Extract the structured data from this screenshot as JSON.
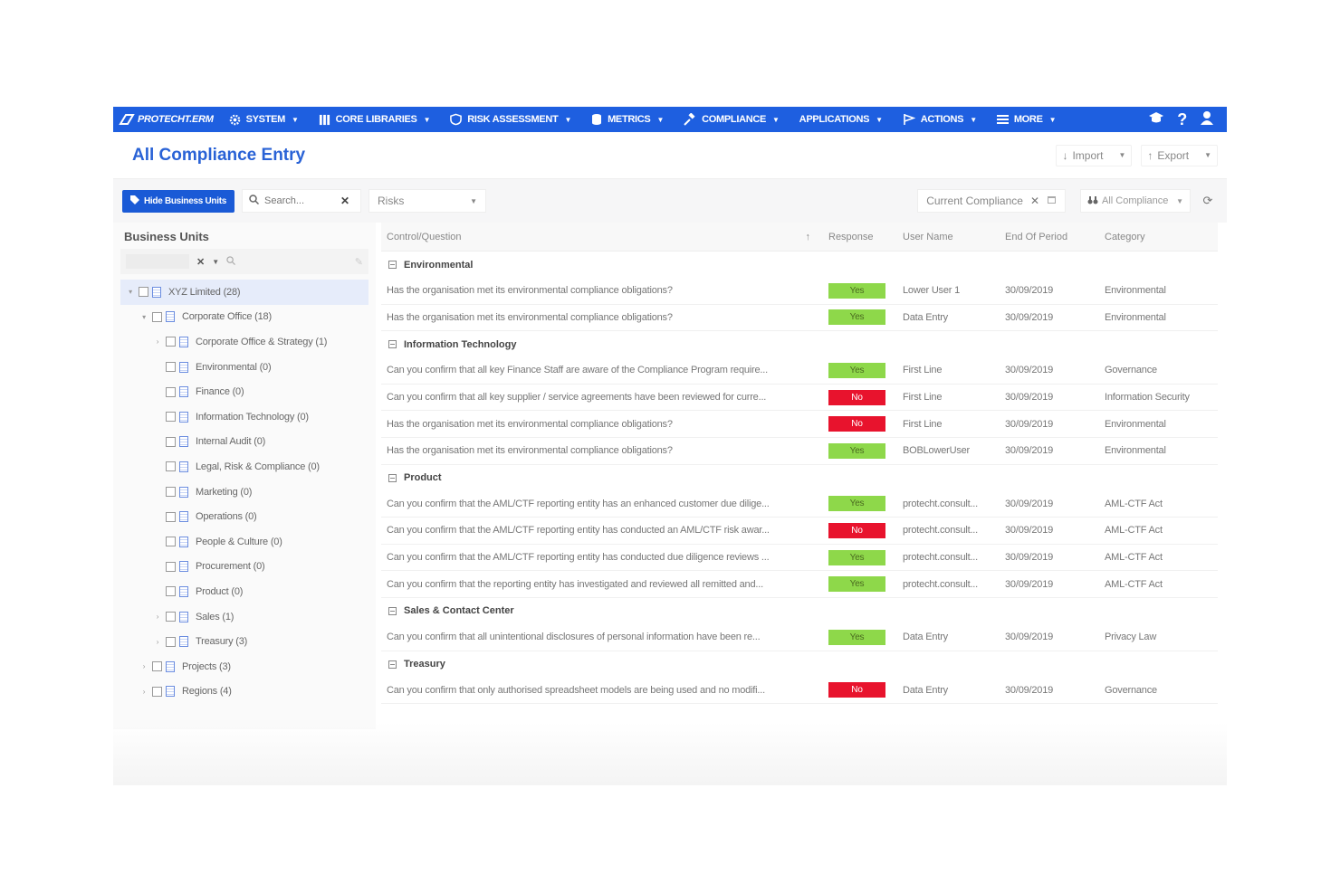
{
  "nav": {
    "brand": "PROTECHT.ERM",
    "items": [
      {
        "label": "SYSTEM",
        "icon": "gear-icon"
      },
      {
        "label": "CORE LIBRARIES",
        "icon": "library-icon"
      },
      {
        "label": "RISK ASSESSMENT",
        "icon": "shield-icon"
      },
      {
        "label": "METRICS",
        "icon": "database-icon"
      },
      {
        "label": "COMPLIANCE",
        "icon": "gavel-icon"
      },
      {
        "label": "APPLICATIONS",
        "icon": ""
      },
      {
        "label": "ACTIONS",
        "icon": "flag-icon"
      },
      {
        "label": "MORE",
        "icon": "menu-icon"
      }
    ],
    "right_icons": [
      "graduation-cap-icon",
      "help-icon",
      "user-icon"
    ],
    "help_glyph": "?"
  },
  "header": {
    "title": "All Compliance Entry",
    "import_label": "Import",
    "export_label": "Export"
  },
  "toolbar": {
    "hide_bu_label": "Hide Business Units",
    "search_placeholder": "Search...",
    "risk_select": "Risks",
    "filter_chip": "Current Compliance",
    "view_select": "All Compliance"
  },
  "sidebar": {
    "title": "Business Units",
    "tree": [
      {
        "label": "XYZ Limited (28)",
        "level": 0,
        "toggle": "open",
        "selected": true
      },
      {
        "label": "Corporate Office (18)",
        "level": 1,
        "toggle": "open"
      },
      {
        "label": "Corporate Office & Strategy (1)",
        "level": 2,
        "toggle": "closed"
      },
      {
        "label": "Environmental (0)",
        "level": 2,
        "toggle": "none"
      },
      {
        "label": "Finance (0)",
        "level": 2,
        "toggle": "none"
      },
      {
        "label": "Information Technology (0)",
        "level": 2,
        "toggle": "none"
      },
      {
        "label": "Internal Audit (0)",
        "level": 2,
        "toggle": "none"
      },
      {
        "label": "Legal, Risk & Compliance (0)",
        "level": 2,
        "toggle": "none"
      },
      {
        "label": "Marketing (0)",
        "level": 2,
        "toggle": "none"
      },
      {
        "label": "Operations (0)",
        "level": 2,
        "toggle": "none"
      },
      {
        "label": "People & Culture (0)",
        "level": 2,
        "toggle": "none"
      },
      {
        "label": "Procurement (0)",
        "level": 2,
        "toggle": "none"
      },
      {
        "label": "Product (0)",
        "level": 2,
        "toggle": "none"
      },
      {
        "label": "Sales (1)",
        "level": 2,
        "toggle": "closed"
      },
      {
        "label": "Treasury (3)",
        "level": 2,
        "toggle": "closed"
      },
      {
        "label": "Projects (3)",
        "level": 1,
        "toggle": "closed"
      },
      {
        "label": "Regions (4)",
        "level": 1,
        "toggle": "closed"
      }
    ]
  },
  "grid": {
    "columns": [
      "Control/Question",
      "Response",
      "User Name",
      "End Of Period",
      "Category"
    ],
    "groups": [
      {
        "name": "Environmental",
        "rows": [
          {
            "q": "Has the organisation met its environmental compliance obligations?",
            "r": "Yes",
            "u": "Lower User 1",
            "d": "30/09/2019",
            "c": "Environmental"
          },
          {
            "q": "Has the organisation met its environmental compliance obligations?",
            "r": "Yes",
            "u": "Data Entry",
            "d": "30/09/2019",
            "c": "Environmental"
          }
        ]
      },
      {
        "name": "Information Technology",
        "rows": [
          {
            "q": "Can you confirm that all key Finance Staff are aware of the Compliance Program require...",
            "r": "Yes",
            "u": "First Line",
            "d": "30/09/2019",
            "c": "Governance"
          },
          {
            "q": "Can you confirm that all key supplier / service agreements have been reviewed for curre...",
            "r": "No",
            "u": "First Line",
            "d": "30/09/2019",
            "c": "Information Security"
          },
          {
            "q": "Has the organisation met its environmental compliance obligations?",
            "r": "No",
            "u": "First Line",
            "d": "30/09/2019",
            "c": "Environmental"
          },
          {
            "q": "Has the organisation met its environmental compliance obligations?",
            "r": "Yes",
            "u": "BOBLowerUser",
            "d": "30/09/2019",
            "c": "Environmental"
          }
        ]
      },
      {
        "name": "Product",
        "rows": [
          {
            "q": "Can you confirm that the AML/CTF reporting entity has an enhanced customer due dilige...",
            "r": "Yes",
            "u": "protecht.consult...",
            "d": "30/09/2019",
            "c": "AML-CTF Act"
          },
          {
            "q": "Can you confirm that the AML/CTF reporting entity has conducted an AML/CTF risk awar...",
            "r": "No",
            "u": "protecht.consult...",
            "d": "30/09/2019",
            "c": "AML-CTF Act"
          },
          {
            "q": "Can you confirm that the AML/CTF reporting entity has conducted due diligence reviews ...",
            "r": "Yes",
            "u": "protecht.consult...",
            "d": "30/09/2019",
            "c": "AML-CTF Act"
          },
          {
            "q": "Can you confirm that the reporting entity has investigated and reviewed all remitted and...",
            "r": "Yes",
            "u": "protecht.consult...",
            "d": "30/09/2019",
            "c": "AML-CTF Act"
          }
        ]
      },
      {
        "name": "Sales & Contact Center",
        "rows": [
          {
            "q": "Can you confirm that all unintentional disclosures of personal information have been re...",
            "r": "Yes",
            "u": "Data Entry",
            "d": "30/09/2019",
            "c": "Privacy Law"
          }
        ]
      },
      {
        "name": "Treasury",
        "rows": [
          {
            "q": "Can you confirm that only authorised spreadsheet models are being used and no modifi...",
            "r": "No",
            "u": "Data Entry",
            "d": "30/09/2019",
            "c": "Governance"
          }
        ]
      }
    ]
  },
  "colors": {
    "nav_bg": "#1e5fe0",
    "title": "#2962d6",
    "yes": "#8ed84a",
    "no": "#e8132d"
  }
}
